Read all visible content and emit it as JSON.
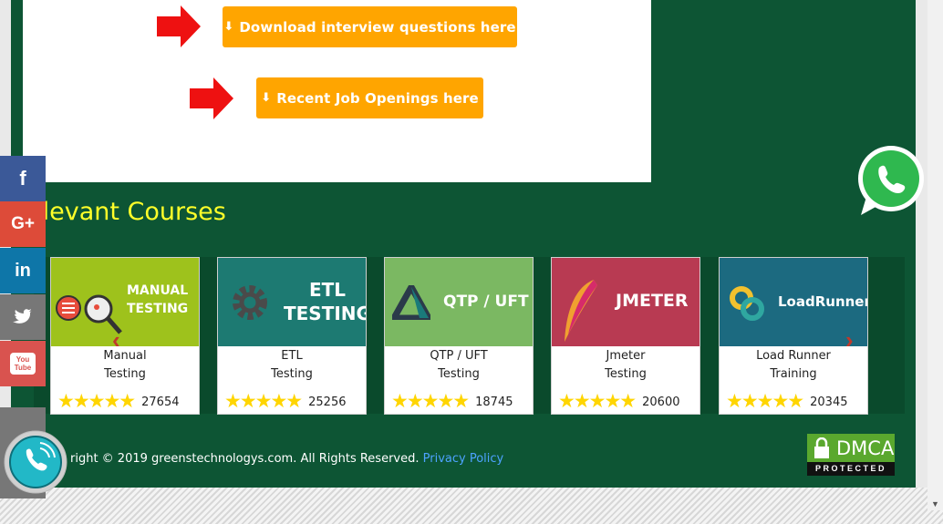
{
  "buttons": {
    "download": "Download interview questions here",
    "jobs": "Recent Job Openings here"
  },
  "section": {
    "title": "elevant Courses"
  },
  "courses": [
    {
      "thumb_line1": "MANUAL",
      "thumb_line2": "TESTING",
      "name1": "Manual",
      "name2": "Testing",
      "count": "27654",
      "color": "#9ec21c"
    },
    {
      "thumb_line1": "ETL",
      "thumb_line2": "TESTING",
      "name1": "ETL",
      "name2": "Testing",
      "count": "25256",
      "color": "#1d7a72"
    },
    {
      "thumb_line1": "QTP / UFT",
      "thumb_line2": "",
      "name1": "QTP / UFT",
      "name2": "Testing",
      "count": "18745",
      "color": "#7bb862"
    },
    {
      "thumb_line1": "JMETER",
      "thumb_line2": "",
      "name1": "Jmeter",
      "name2": "Testing",
      "count": "20600",
      "color": "#b83a52"
    },
    {
      "thumb_line1": "LoadRunner",
      "thumb_line2": "",
      "name1": "Load Runner",
      "name2": "Training",
      "count": "20345",
      "color": "#1c6a80"
    }
  ],
  "stars": "★★★★★",
  "footer": {
    "copyright": "right © 2019 greenstechnologys.com. All Rights Reserved.",
    "privacy": "Privacy Policy"
  },
  "dmca": {
    "label": "DMCA",
    "sub": "PROTECTED"
  },
  "social": [
    {
      "icon": "facebook-icon",
      "glyph": "f",
      "color": "#3b5998"
    },
    {
      "icon": "google-plus-icon",
      "glyph": "G+",
      "color": "#dd4b39"
    },
    {
      "icon": "linkedin-icon",
      "glyph": "in",
      "color": "#0e76a8"
    },
    {
      "icon": "twitter-icon",
      "glyph": "🐦",
      "color": "#777777"
    },
    {
      "icon": "youtube-icon",
      "glyph": "You Tube",
      "color": "#d9534f"
    }
  ]
}
